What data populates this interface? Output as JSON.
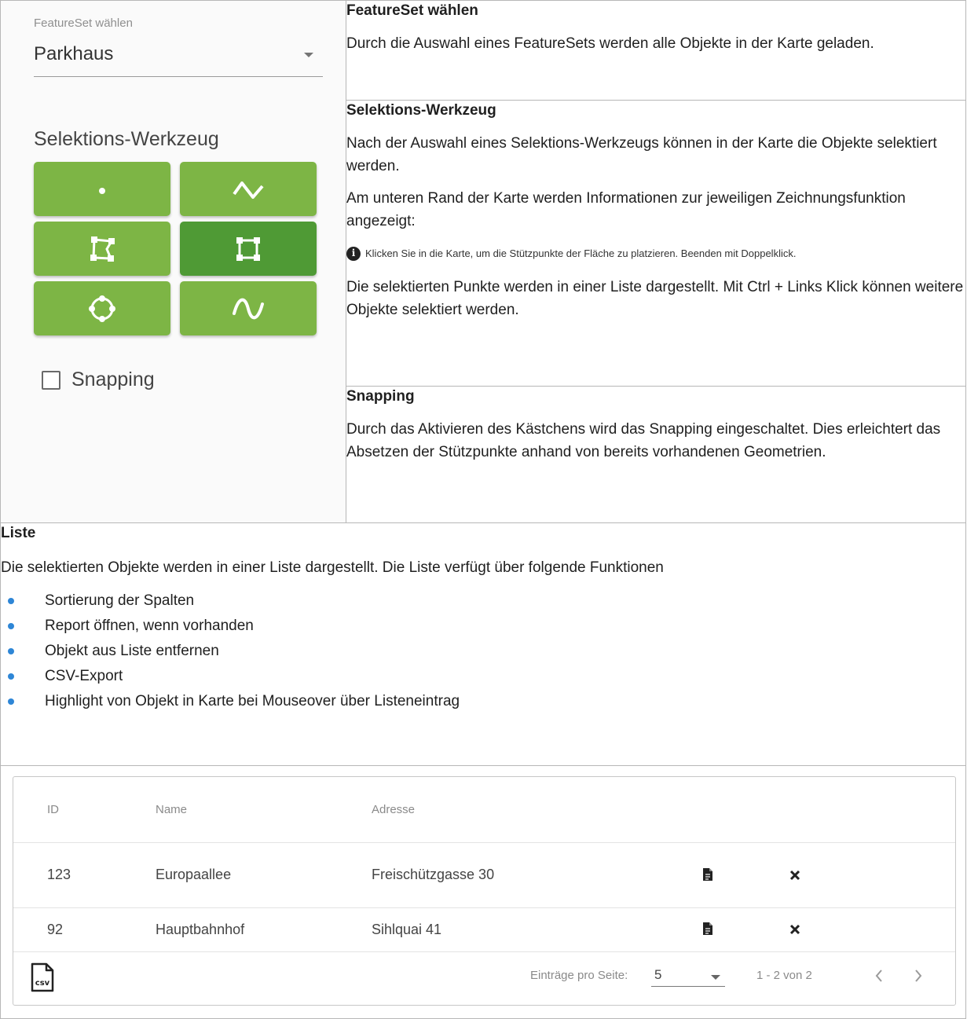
{
  "left_panel": {
    "featureset_label": "FeatureSet wählen",
    "featureset_value": "Parkhaus",
    "tools_heading": "Selektions-Werkzeug",
    "tools": [
      {
        "icon": "point-icon",
        "active": false
      },
      {
        "icon": "polyline-icon",
        "active": false
      },
      {
        "icon": "polygon-icon",
        "active": false
      },
      {
        "icon": "rectangle-icon",
        "active": true
      },
      {
        "icon": "circle-icon",
        "active": false
      },
      {
        "icon": "freehand-icon",
        "active": false
      }
    ],
    "snapping_label": "Snapping",
    "snapping_checked": false,
    "accent_color": "#7db545",
    "active_color": "#4f9a35"
  },
  "sections": {
    "featureset": {
      "title": "FeatureSet wählen",
      "text": "Durch die Auswahl eines FeatureSets werden alle Objekte in der Karte geladen."
    },
    "tool": {
      "title": "Selektions-Werkzeug",
      "p1": "Nach der Auswahl eines Selektions-Werkzeugs können in der Karte die Objekte selektiert werden.",
      "p2": "Am unteren Rand der Karte werden Informationen zur jeweiligen Zeichnungsfunktion angezeigt:",
      "hint": "Klicken Sie in die Karte, um die Stützpunkte der Fläche zu platzieren. Beenden mit Doppelklick.",
      "p3": "Die selektierten Punkte werden in einer Liste dargestellt. Mit Ctrl + Links Klick können weitere Objekte selektiert werden."
    },
    "snapping": {
      "title": "Snapping",
      "text": "Durch das Aktivieren des Kästchens wird das Snapping eingeschaltet. Dies erleichtert das Absetzen der Stützpunkte anhand von bereits vorhandenen Geometrien."
    },
    "liste": {
      "title": "Liste",
      "intro": "Die selektierten Objekte werden in einer Liste dargestellt. Die Liste verfügt über folgende Funktionen",
      "items": [
        "Sortierung der Spalten",
        "Report öffnen, wenn vorhanden",
        "Objekt aus Liste entfernen",
        "CSV-Export",
        "Highlight von Objekt in Karte bei Mouseover über Listeneintrag"
      ],
      "bullet_color": "#2e86d6"
    }
  },
  "table": {
    "columns": [
      "ID",
      "Name",
      "Adresse"
    ],
    "rows": [
      {
        "id": "123",
        "name": "Europaallee",
        "address": "Freischützgasse 30"
      },
      {
        "id": "92",
        "name": "Hauptbahnhof",
        "address": "Sihlquai 41"
      }
    ],
    "csv_label": "csv",
    "page_size_label": "Einträge pro Seite:",
    "page_size": "5",
    "range": "1 - 2 von 2"
  }
}
